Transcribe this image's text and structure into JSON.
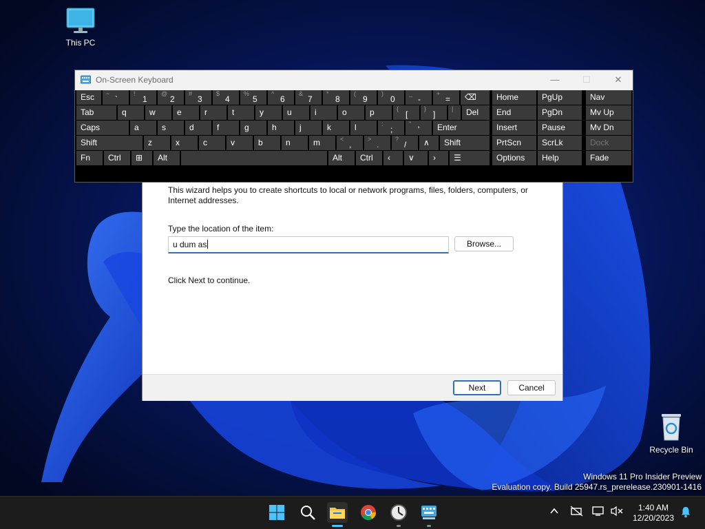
{
  "desktop": {
    "icons": [
      {
        "label": "This PC"
      },
      {
        "label": "Recycle Bin"
      }
    ],
    "watermark": {
      "line1": "Windows 11 Pro Insider Preview",
      "line2": "Evaluation copy. Build 25947.rs_prerelease.230901-1416"
    }
  },
  "wizard": {
    "description": "This wizard helps you to create shortcuts to local or network programs, files, folders, computers, or Internet addresses.",
    "location_label": "Type the location of the item:",
    "location_value": "u dum as",
    "browse_label": "Browse...",
    "continue_text": "Click Next to continue.",
    "next_label": "Next",
    "cancel_label": "Cancel"
  },
  "osk": {
    "title": "On-Screen Keyboard",
    "window_controls": {
      "minimize": "—",
      "maximize": "☐",
      "close": "✕"
    },
    "rows": [
      [
        {
          "p": "Esc"
        },
        {
          "s": "~",
          "m": "`"
        },
        {
          "s": "!",
          "m": "1"
        },
        {
          "s": "@",
          "m": "2"
        },
        {
          "s": "#",
          "m": "3"
        },
        {
          "s": "$",
          "m": "4"
        },
        {
          "s": "%",
          "m": "5"
        },
        {
          "s": "^",
          "m": "6"
        },
        {
          "s": "&",
          "m": "7"
        },
        {
          "s": "*",
          "m": "8"
        },
        {
          "s": "(",
          "m": "9"
        },
        {
          "s": ")",
          "m": "0"
        },
        {
          "s": "_",
          "m": "-"
        },
        {
          "s": "+",
          "m": "="
        },
        {
          "p": "⌫"
        }
      ],
      [
        {
          "p": "Tab"
        },
        {
          "p": "q"
        },
        {
          "p": "w"
        },
        {
          "p": "e"
        },
        {
          "p": "r"
        },
        {
          "p": "t"
        },
        {
          "p": "y"
        },
        {
          "p": "u"
        },
        {
          "p": "i"
        },
        {
          "p": "o"
        },
        {
          "p": "p"
        },
        {
          "s": "{",
          "m": "["
        },
        {
          "s": "}",
          "m": "]"
        },
        {
          "s": "|",
          "m": "\\"
        },
        {
          "p": "Del"
        }
      ],
      [
        {
          "p": "Caps"
        },
        {
          "p": "a"
        },
        {
          "p": "s"
        },
        {
          "p": "d"
        },
        {
          "p": "f"
        },
        {
          "p": "g"
        },
        {
          "p": "h"
        },
        {
          "p": "j"
        },
        {
          "p": "k"
        },
        {
          "p": "l"
        },
        {
          "s": ":",
          "m": ";"
        },
        {
          "s": "\"",
          "m": "'"
        },
        {
          "p": "Enter"
        }
      ],
      [
        {
          "p": "Shift"
        },
        {
          "p": "z"
        },
        {
          "p": "x"
        },
        {
          "p": "c"
        },
        {
          "p": "v"
        },
        {
          "p": "b"
        },
        {
          "p": "n"
        },
        {
          "p": "m"
        },
        {
          "s": "<",
          "m": ","
        },
        {
          "s": ">",
          "m": "."
        },
        {
          "s": "?",
          "m": "/"
        },
        {
          "p": "∧"
        },
        {
          "p": "Shift"
        }
      ],
      [
        {
          "p": "Fn"
        },
        {
          "p": "Ctrl"
        },
        {
          "p": "⊞"
        },
        {
          "p": "Alt"
        },
        {
          "p": ""
        },
        {
          "p": "Alt"
        },
        {
          "p": "Ctrl"
        },
        {
          "p": "‹"
        },
        {
          "p": "∨"
        },
        {
          "p": "›"
        },
        {
          "p": "☰"
        }
      ]
    ],
    "nav_keys": [
      [
        "Home",
        "PgUp",
        "Nav"
      ],
      [
        "End",
        "PgDn",
        "Mv Up"
      ],
      [
        "Insert",
        "Pause",
        "Mv Dn"
      ],
      [
        "PrtScn",
        "ScrLk",
        "Dock"
      ],
      [
        "Options",
        "Help",
        "Fade"
      ]
    ]
  },
  "taskbar": {
    "apps": [
      "start-icon",
      "search-icon",
      "file-explorer-icon",
      "chrome-icon",
      "clock-app-icon",
      "on-screen-keyboard-icon"
    ],
    "clock": {
      "time": "1:40 AM",
      "date": "12/20/2023"
    }
  }
}
